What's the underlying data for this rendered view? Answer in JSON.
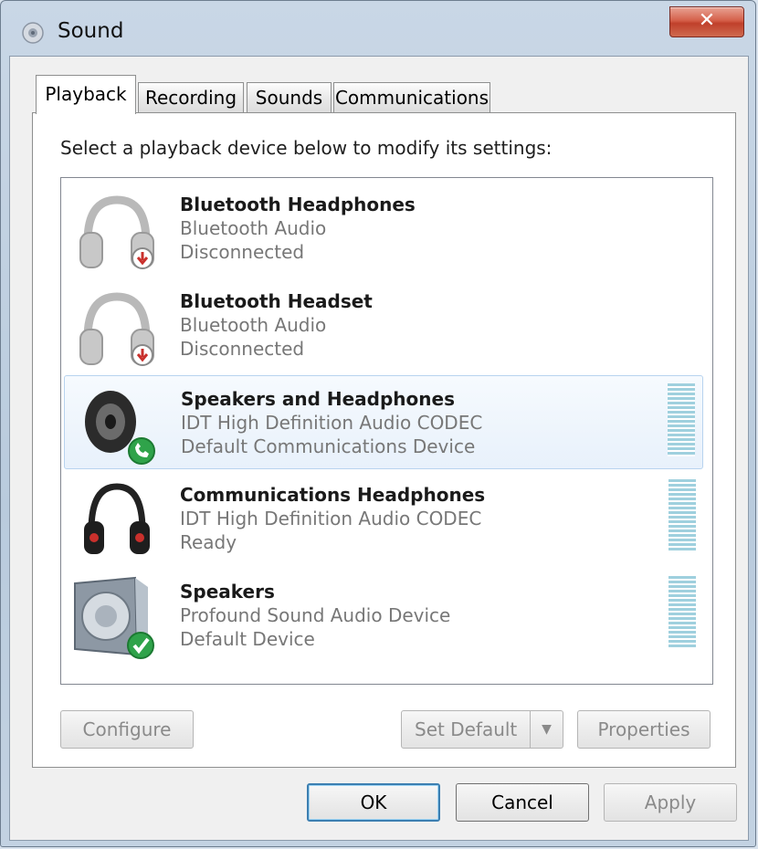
{
  "window": {
    "title": "Sound",
    "close_label": "✕",
    "close_icon": "close-icon"
  },
  "tabs": [
    {
      "label": "Playback",
      "active": true
    },
    {
      "label": "Recording",
      "active": false
    },
    {
      "label": "Sounds",
      "active": false
    },
    {
      "label": "Communications",
      "active": false
    }
  ],
  "instruction": "Select a playback device below to modify its settings:",
  "devices": [
    {
      "name": "Bluetooth Headphones",
      "driver": "Bluetooth Audio",
      "status": "Disconnected",
      "icon": "headphones-disconnected-icon",
      "badge": "disconnected-badge-icon",
      "level_meter": false,
      "selected": false
    },
    {
      "name": "Bluetooth Headset",
      "driver": "Bluetooth Audio",
      "status": "Disconnected",
      "icon": "headset-disconnected-icon",
      "badge": "disconnected-badge-icon",
      "level_meter": false,
      "selected": false
    },
    {
      "name": "Speakers and Headphones",
      "driver": "IDT High Definition Audio CODEC",
      "status": "Default Communications Device",
      "icon": "speaker-icon",
      "badge": "phone-badge-icon",
      "level_meter": true,
      "selected": true
    },
    {
      "name": "Communications Headphones",
      "driver": "IDT High Definition Audio CODEC",
      "status": "Ready",
      "icon": "headphones-icon",
      "badge": null,
      "level_meter": true,
      "selected": false
    },
    {
      "name": "Speakers",
      "driver": "Profound Sound Audio Device",
      "status": "Default Device",
      "icon": "speaker-box-icon",
      "badge": "check-badge-icon",
      "level_meter": true,
      "selected": false
    }
  ],
  "panel_buttons": {
    "configure": "Configure",
    "set_default": "Set Default",
    "set_default_arrow": "▼",
    "properties": "Properties"
  },
  "dialog_buttons": {
    "ok": "OK",
    "cancel": "Cancel",
    "apply": "Apply"
  },
  "colors": {
    "level_meter": "#9fd0de",
    "selected_row": "#e8f1fb",
    "disconnected_badge": "#c9302c",
    "ok_badge": "#2fa34a"
  }
}
